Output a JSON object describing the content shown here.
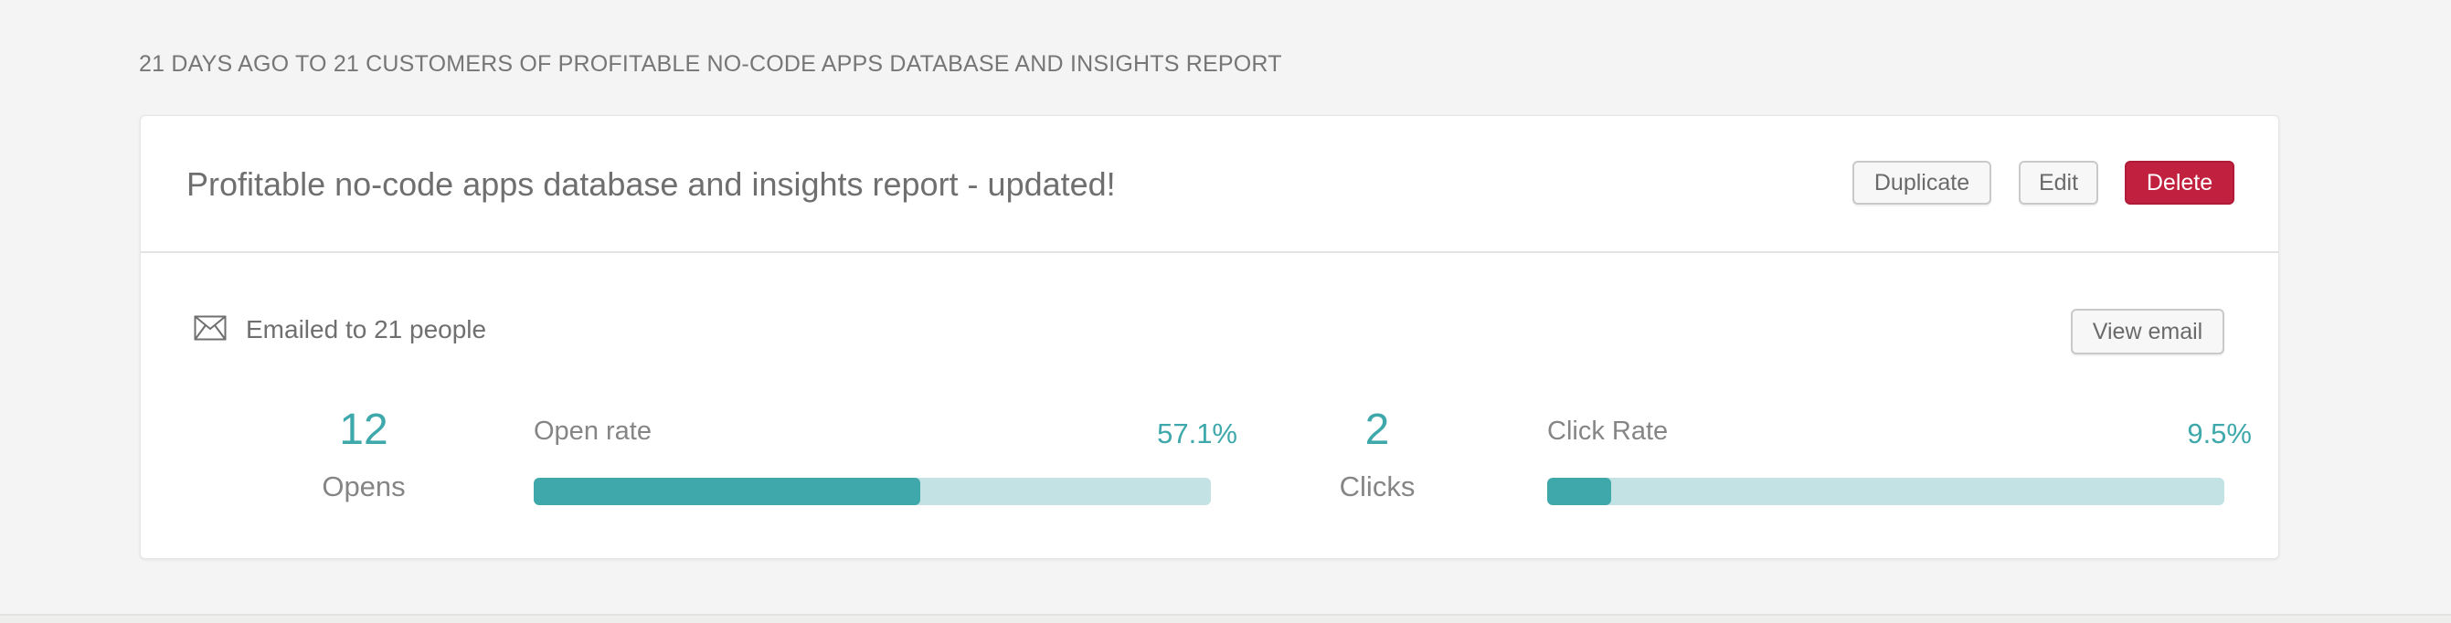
{
  "section_heading": "21 DAYS AGO TO 21 CUSTOMERS OF PROFITABLE NO-CODE APPS DATABASE AND INSIGHTS REPORT",
  "card": {
    "title": "Profitable no-code apps database and insights report - updated!",
    "actions": {
      "duplicate_label": "Duplicate",
      "edit_label": "Edit",
      "delete_label": "Delete"
    },
    "emailed": {
      "icon": "envelope-icon",
      "text": "Emailed to 21 people"
    },
    "view_email_label": "View email",
    "stats": {
      "opens": {
        "value": "12",
        "label": "Opens"
      },
      "open_rate": {
        "label": "Open rate",
        "value": "57.1%",
        "fraction": 0.571
      },
      "clicks": {
        "value": "2",
        "label": "Clicks"
      },
      "click_rate": {
        "label": "Click Rate",
        "value": "9.5%",
        "fraction": 0.095
      }
    }
  },
  "colors": {
    "accent": "#3ea8ab",
    "accent_light": "#c2e2e3",
    "danger": "#c2203f",
    "background": "#f4f4f4"
  }
}
